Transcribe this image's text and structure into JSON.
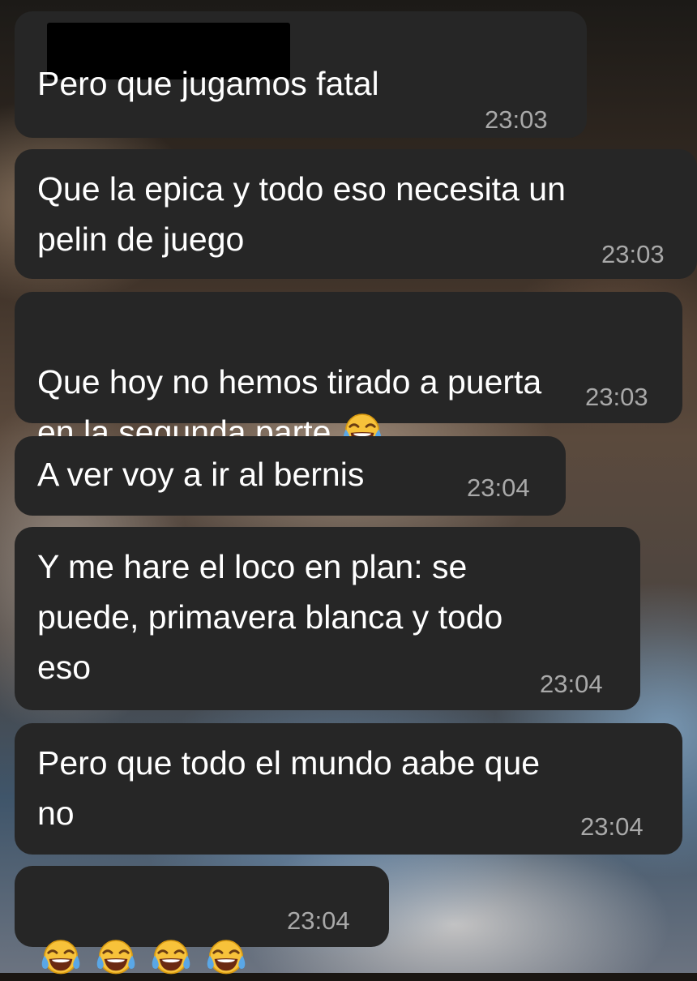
{
  "messages": [
    {
      "text": "Pero que jugamos fatal",
      "time": "23:03",
      "redacted_header": true
    },
    {
      "text": "Que la epica y todo eso necesita un\npelin de juego",
      "time": "23:03"
    },
    {
      "text": "Que hoy no hemos tirado a puerta\nen la segunda parte",
      "emoji": [
        "face-with-tears-of-joy-icon"
      ],
      "time": "23:03"
    },
    {
      "text": "A ver voy a ir al bernis",
      "time": "23:04"
    },
    {
      "text": "Y me hare el loco en plan: se\npuede, primavera blanca y todo\neso",
      "time": "23:04"
    },
    {
      "text": "Pero que todo el mundo aabe que\nno",
      "time": "23:04"
    },
    {
      "text": "",
      "emoji": [
        "face-with-tears-of-joy-icon",
        "face-with-tears-of-joy-icon",
        "face-with-tears-of-joy-icon",
        "face-with-tears-of-joy-icon"
      ],
      "time": "23:04"
    }
  ],
  "colors": {
    "bubble_bg": "#262626",
    "text": "#ffffff",
    "timestamp": "#a9a9a9",
    "emoji_yellow": "#f7c23a",
    "emoji_tears": "#5aa7e6"
  }
}
